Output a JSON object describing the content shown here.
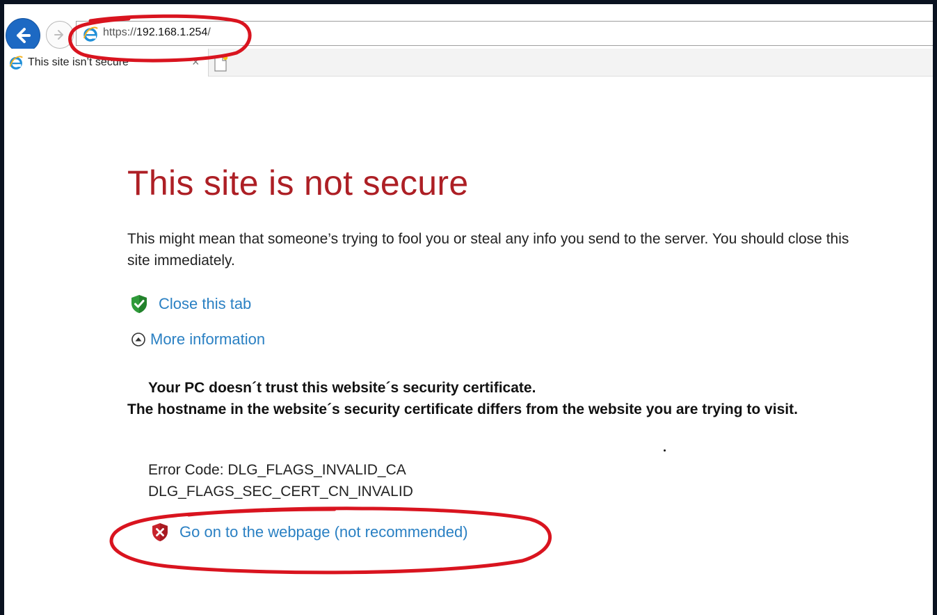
{
  "browser": {
    "address_scheme": "https://",
    "address_host": "192.168.1.254",
    "address_path": "/",
    "tab_title": "This site isn’t secure",
    "tab_close_glyph": "×"
  },
  "page": {
    "title": "This site is not secure",
    "description": "This might mean that someone’s trying to fool you or steal any info you send to the server. You should close this site immediately.",
    "close_tab_link": "Close this tab",
    "more_info_link": "More information",
    "cert_line1": "Your PC doesn´t trust this website´s security certificate.",
    "cert_line2": "The hostname in the website´s security certificate differs from the website you are trying to visit.",
    "error_code_line1": "Error Code: DLG_FLAGS_INVALID_CA",
    "error_code_line2": "DLG_FLAGS_SEC_CERT_CN_INVALID",
    "go_on_link": "Go on to the webpage (not recommended)"
  },
  "icons": {
    "back": "back-arrow-icon",
    "forward": "forward-arrow-icon",
    "ie": "internet-explorer-icon",
    "new_tab": "new-tab-icon",
    "shield_ok": "green-shield-check-icon",
    "expand": "collapse-chevron-circle-icon",
    "shield_warn": "red-shield-x-icon"
  },
  "colors": {
    "title_red": "#ad1f25",
    "link_blue": "#2a80c3",
    "back_button_blue": "#1d69c3",
    "annotation_red": "#d9141f",
    "shield_green": "#2f9a3a",
    "shield_red": "#c8232c"
  }
}
